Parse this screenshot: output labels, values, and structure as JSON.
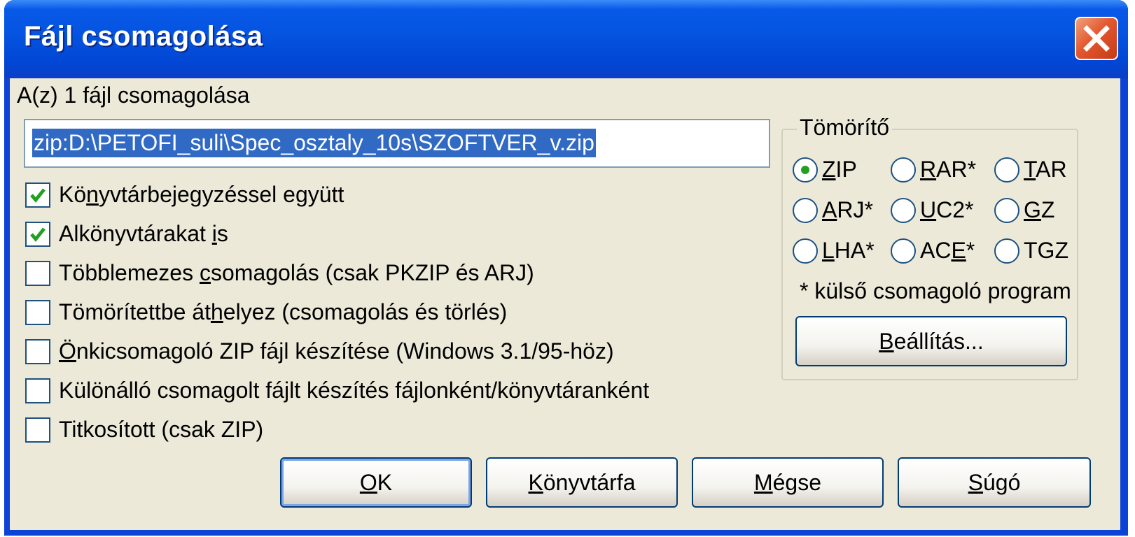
{
  "window": {
    "title": "Fájl csomagolása"
  },
  "caption": "A(z) 1 fájl csomagolása",
  "path_input": {
    "value": "zip:D:\\PETOFI_suli\\Spec_osztaly_10s\\SZOFTVER_v.zip"
  },
  "options": [
    {
      "before": "Kö",
      "accel": "n",
      "after": "yvtárbejegyzéssel együtt",
      "checked": true
    },
    {
      "before": "Alkönyvtárakat ",
      "accel": "i",
      "after": "s",
      "checked": true
    },
    {
      "before": "Többlemezes ",
      "accel": "c",
      "after": "somagolás (csak PKZIP és ARJ)",
      "checked": false
    },
    {
      "before": "Tömörítettbe át",
      "accel": "h",
      "after": "elyez (csomagolás és törlés)",
      "checked": false
    },
    {
      "before": "",
      "accel": "Ö",
      "after": "nkicsomagoló ZIP fájl készítése (Windows 3.1/95-höz)",
      "checked": false
    },
    {
      "before": "Különálló csomagolt fájlt készítés fájlonként/könyvtáranként",
      "accel": "",
      "after": "",
      "checked": false
    },
    {
      "before": "Titkosított (csak ZIP)",
      "accel": "",
      "after": "",
      "checked": false
    }
  ],
  "compressor": {
    "legend": "Tömörítő",
    "radios": [
      {
        "before": "",
        "accel": "Z",
        "after": "IP",
        "selected": true
      },
      {
        "before": "",
        "accel": "R",
        "after": "AR*",
        "selected": false
      },
      {
        "before": "",
        "accel": "T",
        "after": "AR",
        "selected": false
      },
      {
        "before": "",
        "accel": "A",
        "after": "RJ*",
        "selected": false
      },
      {
        "before": "",
        "accel": "U",
        "after": "C2*",
        "selected": false
      },
      {
        "before": "",
        "accel": "G",
        "after": "Z",
        "selected": false
      },
      {
        "before": "",
        "accel": "L",
        "after": "HA*",
        "selected": false
      },
      {
        "before": "AC",
        "accel": "E",
        "after": "*",
        "selected": false
      },
      {
        "before": "TGZ",
        "accel": "",
        "after": "",
        "selected": false
      }
    ],
    "note": "* külső csomagoló program",
    "settings_button": {
      "accel": "B",
      "after": "eállítás..."
    }
  },
  "buttons": {
    "ok": {
      "accel": "O",
      "after": "K"
    },
    "folder": {
      "accel": "K",
      "after": "önyvtárfa"
    },
    "cancel": {
      "accel": "M",
      "after": "égse"
    },
    "help": {
      "accel": "S",
      "after": "úgó"
    }
  },
  "colors": {
    "title_bar": "#0553e0",
    "dialog_bg": "#ece9d8",
    "selection": "#316ac5",
    "check": "#21a121",
    "close": "#e2582f"
  }
}
